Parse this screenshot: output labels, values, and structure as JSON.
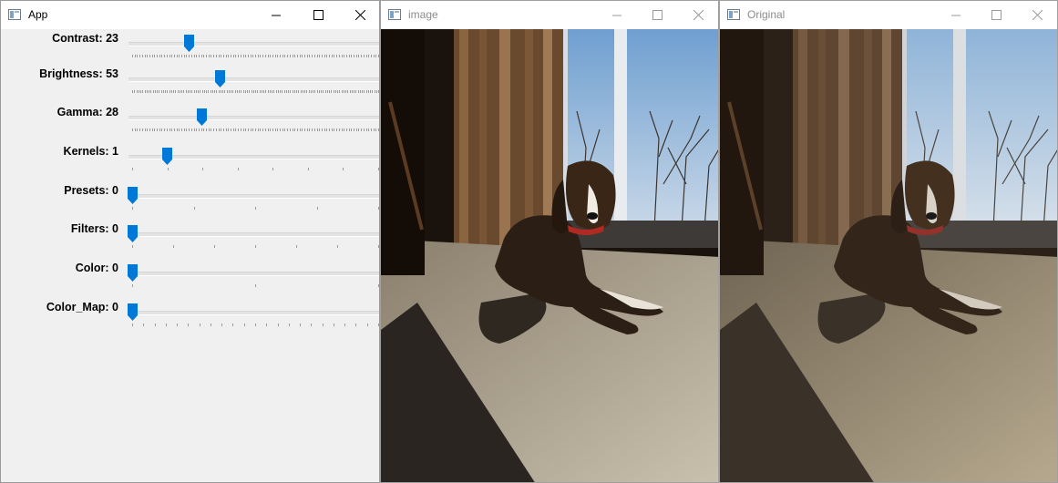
{
  "app_window": {
    "title": "App",
    "sliders": [
      {
        "label": "Contrast: 23",
        "fraction": 0.23,
        "tick_count": 100
      },
      {
        "label": "Brightness: 53",
        "fraction": 0.355,
        "tick_count": 120
      },
      {
        "label": "Gamma: 28",
        "fraction": 0.28,
        "tick_count": 100
      },
      {
        "label": "Kernels: 1",
        "fraction": 0.142,
        "tick_count": 7
      },
      {
        "label": "Presets: 0",
        "fraction": 0.0,
        "tick_count": 4
      },
      {
        "label": "Filters: 0",
        "fraction": 0.0,
        "tick_count": 6
      },
      {
        "label": "Color: 0",
        "fraction": 0.0,
        "tick_count": 2
      },
      {
        "label": "Color_Map: 0",
        "fraction": 0.0,
        "tick_count": 22
      }
    ]
  },
  "image_window": {
    "title": "image",
    "variant": "adjusted"
  },
  "original_window": {
    "title": "Original",
    "variant": "original"
  },
  "colors": {
    "accent": "#0078d7"
  }
}
